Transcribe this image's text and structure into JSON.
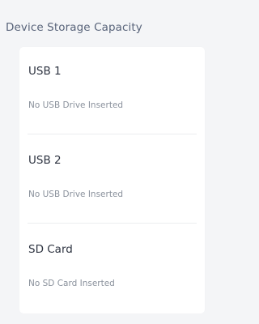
{
  "panel": {
    "title": "Device Storage Capacity"
  },
  "storage": [
    {
      "name": "USB 1",
      "status": "No USB Drive Inserted"
    },
    {
      "name": "USB 2",
      "status": "No USB Drive Inserted"
    },
    {
      "name": "SD Card",
      "status": "No SD Card Inserted"
    }
  ],
  "colors": {
    "page_background": "#f4f5f7",
    "card_background": "#ffffff",
    "title_text": "#59647a",
    "name_text": "#2e3441",
    "status_text": "#8a919c",
    "divider": "#ebedf0"
  }
}
